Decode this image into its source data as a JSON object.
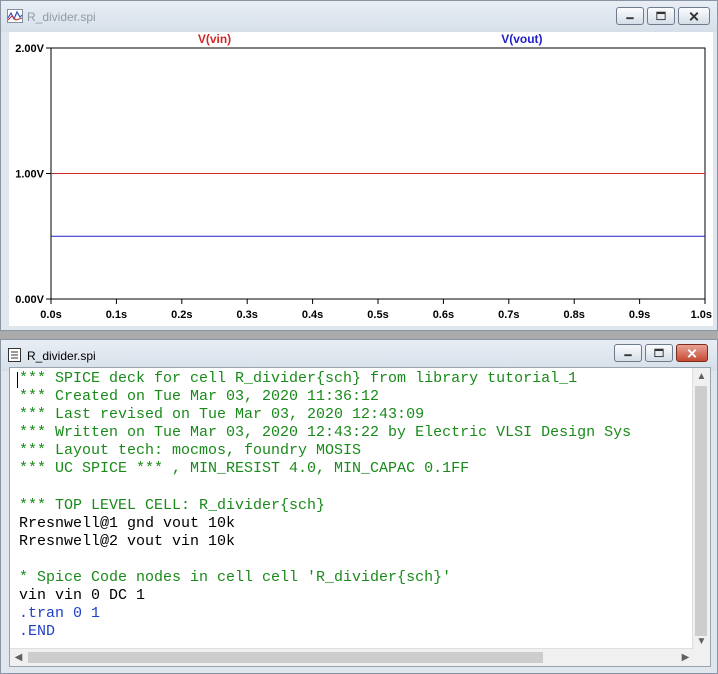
{
  "plot_window": {
    "title": "R_divider.spi",
    "icon": "waveform-icon",
    "buttons": [
      "minimize-icon",
      "maximize-icon",
      "close-icon"
    ]
  },
  "text_window": {
    "title": "R_divider.spi",
    "icon": "netlist-file-icon",
    "buttons": [
      "minimize-icon",
      "maximize-icon",
      "close-icon"
    ],
    "lines": [
      {
        "text": "*** SPICE deck for cell R_divider{sch} from library tutorial_1",
        "style": "c"
      },
      {
        "text": "*** Created on Tue Mar 03, 2020 11:36:12",
        "style": "c"
      },
      {
        "text": "*** Last revised on Tue Mar 03, 2020 12:43:09",
        "style": "c"
      },
      {
        "text": "*** Written on Tue Mar 03, 2020 12:43:22 by Electric VLSI Design Sys",
        "style": "c"
      },
      {
        "text": "*** Layout tech: mocmos, foundry MOSIS",
        "style": "c"
      },
      {
        "text": "*** UC SPICE *** , MIN_RESIST 4.0, MIN_CAPAC 0.1FF",
        "style": "c"
      },
      {
        "text": "",
        "style": "k"
      },
      {
        "text": "*** TOP LEVEL CELL: R_divider{sch}",
        "style": "c"
      },
      {
        "text": "Rresnwell@1 gnd vout 10k",
        "style": "k"
      },
      {
        "text": "Rresnwell@2 vout vin 10k",
        "style": "k"
      },
      {
        "text": "",
        "style": "k"
      },
      {
        "text": "* Spice Code nodes in cell cell 'R_divider{sch}'",
        "style": "c"
      },
      {
        "text": "vin vin 0 DC 1",
        "style": "k"
      },
      {
        "text": ".tran 0 1",
        "style": "d"
      },
      {
        "text": ".END",
        "style": "d"
      }
    ]
  },
  "chart_data": {
    "type": "line",
    "x_ticks": [
      "0.0s",
      "0.1s",
      "0.2s",
      "0.3s",
      "0.4s",
      "0.5s",
      "0.6s",
      "0.7s",
      "0.8s",
      "0.9s",
      "1.0s"
    ],
    "y_ticks": [
      "0.00V",
      "1.00V",
      "2.00V"
    ],
    "xlim": [
      0,
      1
    ],
    "ylim": [
      0,
      2
    ],
    "grid": false,
    "legend": "top",
    "series": [
      {
        "name": "V(vin)",
        "color": "#d22828",
        "x": [
          0,
          1
        ],
        "y": [
          1.0,
          1.0
        ]
      },
      {
        "name": "V(vout)",
        "color": "#2121c8",
        "x": [
          0,
          1
        ],
        "y": [
          0.5,
          0.5
        ]
      }
    ]
  }
}
